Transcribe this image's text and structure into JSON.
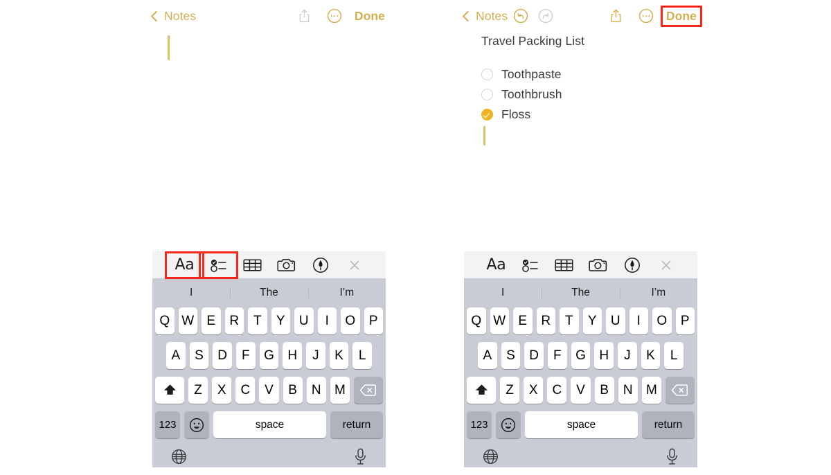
{
  "panels": [
    {
      "id": "left",
      "navbar": {
        "back_label": "Notes",
        "back_icon": "chevron-left-icon",
        "undo_icon": null,
        "redo_icon": null,
        "share_icon": "share-icon",
        "share_state": "disabled",
        "more_icon": "more-ellipsis-icon",
        "more_state": "active",
        "done_label": "Done",
        "done_highlighted": false
      },
      "note": {
        "title": "",
        "checklist": [],
        "caret_visible": true
      },
      "toolbar": {
        "items": [
          {
            "icon": "text-format-icon",
            "label": "Aa",
            "highlighted": true
          },
          {
            "icon": "checklist-icon",
            "label": "",
            "highlighted": true
          },
          {
            "icon": "table-icon",
            "label": "",
            "highlighted": false
          },
          {
            "icon": "camera-icon",
            "label": "",
            "highlighted": false
          },
          {
            "icon": "markup-pen-icon",
            "label": "",
            "highlighted": false
          },
          {
            "icon": "close-icon",
            "label": "",
            "highlighted": false
          }
        ]
      }
    },
    {
      "id": "right",
      "navbar": {
        "back_label": "Notes",
        "back_icon": "chevron-left-icon",
        "undo_icon": "undo-icon",
        "undo_state": "active",
        "redo_icon": "redo-icon",
        "redo_state": "disabled",
        "share_icon": "share-icon",
        "share_state": "active",
        "more_icon": "more-ellipsis-icon",
        "more_state": "active",
        "done_label": "Done",
        "done_highlighted": true
      },
      "note": {
        "title": "Travel Packing List",
        "checklist": [
          {
            "label": "Toothpaste",
            "checked": false
          },
          {
            "label": "Toothbrush",
            "checked": false
          },
          {
            "label": "Floss",
            "checked": true
          }
        ],
        "caret_visible": true
      },
      "toolbar": {
        "items": [
          {
            "icon": "text-format-icon",
            "label": "Aa",
            "highlighted": false
          },
          {
            "icon": "checklist-icon",
            "label": "",
            "highlighted": false
          },
          {
            "icon": "table-icon",
            "label": "",
            "highlighted": false
          },
          {
            "icon": "camera-icon",
            "label": "",
            "highlighted": false
          },
          {
            "icon": "markup-pen-icon",
            "label": "",
            "highlighted": false
          },
          {
            "icon": "close-icon",
            "label": "",
            "highlighted": false
          }
        ]
      }
    }
  ],
  "keyboard": {
    "predictions": [
      "I",
      "The",
      "I’m"
    ],
    "row1": [
      "Q",
      "W",
      "E",
      "R",
      "T",
      "Y",
      "U",
      "I",
      "O",
      "P"
    ],
    "row2": [
      "A",
      "S",
      "D",
      "F",
      "G",
      "H",
      "J",
      "K",
      "L"
    ],
    "row3": [
      "Z",
      "X",
      "C",
      "V",
      "B",
      "N",
      "M"
    ],
    "shift_icon": "shift-up-arrow-icon",
    "backspace_icon": "backspace-delete-icon",
    "numbers_label": "123",
    "emoji_icon": "emoji-smiley-icon",
    "space_label": "space",
    "return_label": "return",
    "globe_icon": "globe-language-icon",
    "mic_icon": "microphone-dictation-icon"
  },
  "colors": {
    "accent_gold": "#d4af50",
    "check_gold": "#f0b323",
    "highlight_red": "#f42718",
    "keyboard_bg": "#c9ccd4",
    "toolbar_bg": "#f3f3f5",
    "text_dark": "#3b3b3d"
  }
}
